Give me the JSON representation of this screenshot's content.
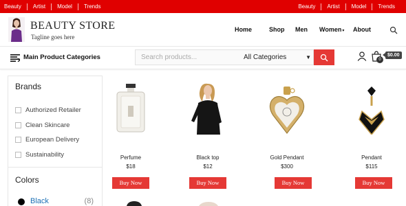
{
  "topbar": {
    "left_links": [
      "Beauty",
      "Artist",
      "Model",
      "Trends"
    ],
    "right_links": [
      "Beauty",
      "Artist",
      "Model",
      "Trends"
    ]
  },
  "header": {
    "store_name": "BEAUTY STORE",
    "tagline": "Tagline goes here",
    "nav": [
      "Home",
      "Shop",
      "Men",
      "Women",
      "About"
    ]
  },
  "catbar": {
    "label": "Main Product Categories",
    "search_placeholder": "Search products...",
    "category_select": "All Categories",
    "cart_count": "0",
    "cart_total": "$0.00"
  },
  "sidebar": {
    "brands_title": "Brands",
    "brands": [
      "Authorized Retailer",
      "Clean Skincare",
      "European Delivery",
      "Sustainability"
    ],
    "colors_title": "Colors",
    "colors": [
      {
        "name": "Black",
        "count": "(8)",
        "swatch": "#000000"
      }
    ]
  },
  "products": [
    {
      "name": "Perfume",
      "price": "$18",
      "button": "Buy Now"
    },
    {
      "name": "Black top",
      "price": "$12",
      "button": "Buy Now"
    },
    {
      "name": "Gold Pendant",
      "price": "$300",
      "button": "Buy Now"
    },
    {
      "name": "Pendant",
      "price": "$115",
      "button": "Buy Now"
    }
  ],
  "colors": {
    "accent_red": "#e00000",
    "button_red": "#e53935",
    "link_blue": "#1a6fb5"
  }
}
